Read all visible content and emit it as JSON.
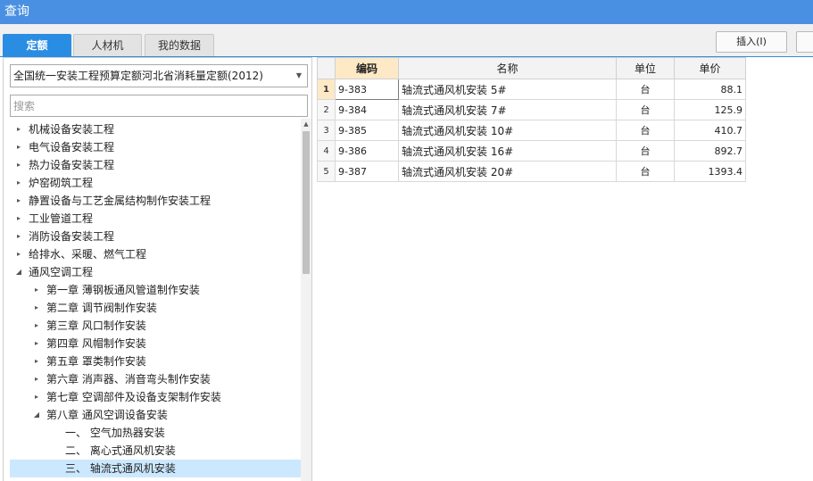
{
  "window": {
    "title": "查询"
  },
  "tabs": [
    {
      "label": "定额",
      "active": true
    },
    {
      "label": "人材机",
      "active": false
    },
    {
      "label": "我的数据",
      "active": false
    }
  ],
  "toolbar": {
    "insert_label": "插入(I)"
  },
  "left": {
    "quota_select": "全国统一安装工程预算定额河北省消耗量定额(2012)",
    "search_placeholder": "搜索",
    "tree": [
      {
        "label": "机械设备安装工程",
        "level": 0,
        "state": "collapsed"
      },
      {
        "label": "电气设备安装工程",
        "level": 0,
        "state": "collapsed"
      },
      {
        "label": "热力设备安装工程",
        "level": 0,
        "state": "collapsed"
      },
      {
        "label": "炉窑砌筑工程",
        "level": 0,
        "state": "collapsed"
      },
      {
        "label": "静置设备与工艺金属结构制作安装工程",
        "level": 0,
        "state": "collapsed"
      },
      {
        "label": "工业管道工程",
        "level": 0,
        "state": "collapsed"
      },
      {
        "label": "消防设备安装工程",
        "level": 0,
        "state": "collapsed"
      },
      {
        "label": "给排水、采暖、燃气工程",
        "level": 0,
        "state": "collapsed"
      },
      {
        "label": "通风空调工程",
        "level": 0,
        "state": "expanded"
      },
      {
        "label": "第一章  薄钢板通风管道制作安装",
        "level": 1,
        "state": "collapsed"
      },
      {
        "label": "第二章  调节阀制作安装",
        "level": 1,
        "state": "collapsed"
      },
      {
        "label": "第三章  风口制作安装",
        "level": 1,
        "state": "collapsed"
      },
      {
        "label": "第四章  风帽制作安装",
        "level": 1,
        "state": "collapsed"
      },
      {
        "label": "第五章  罩类制作安装",
        "level": 1,
        "state": "collapsed"
      },
      {
        "label": "第六章  消声器、消音弯头制作安装",
        "level": 1,
        "state": "collapsed"
      },
      {
        "label": "第七章  空调部件及设备支架制作安装",
        "level": 1,
        "state": "collapsed"
      },
      {
        "label": "第八章  通风空调设备安装",
        "level": 1,
        "state": "expanded"
      },
      {
        "label": "一、  空气加热器安装",
        "level": 2,
        "state": "leaf"
      },
      {
        "label": "二、  离心式通风机安装",
        "level": 2,
        "state": "leaf"
      },
      {
        "label": "三、  轴流式通风机安装",
        "level": 2,
        "state": "leaf",
        "selected": true
      }
    ]
  },
  "grid": {
    "columns": [
      "编码",
      "名称",
      "单位",
      "单价"
    ],
    "rows": [
      {
        "no": "1",
        "code": "9-383",
        "name": "轴流式通风机安装  5#",
        "unit": "台",
        "price": "88.1"
      },
      {
        "no": "2",
        "code": "9-384",
        "name": "轴流式通风机安装  7#",
        "unit": "台",
        "price": "125.9"
      },
      {
        "no": "3",
        "code": "9-385",
        "name": "轴流式通风机安装  10#",
        "unit": "台",
        "price": "410.7"
      },
      {
        "no": "4",
        "code": "9-386",
        "name": "轴流式通风机安装  16#",
        "unit": "台",
        "price": "892.7"
      },
      {
        "no": "5",
        "code": "9-387",
        "name": "轴流式通风机安装  20#",
        "unit": "台",
        "price": "1393.4"
      }
    ]
  },
  "colors": {
    "accent": "#2a8de4",
    "titlebar": "#4a90e2",
    "header_highlight": "#fde9c6",
    "selection": "#cce8ff"
  },
  "icons": {
    "dropdown": "chevron-down-icon",
    "collapsed": "caret-right-icon",
    "expanded": "caret-down-icon"
  }
}
